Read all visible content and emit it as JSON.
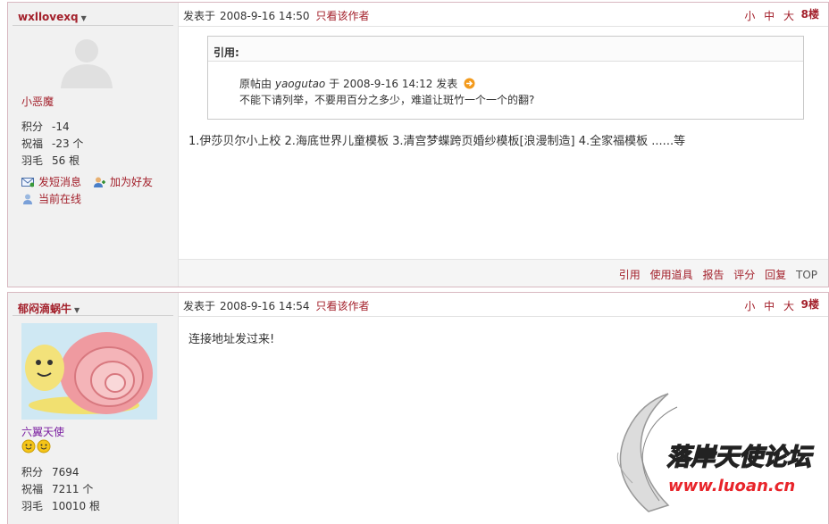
{
  "posts": [
    {
      "username": "wxllovexq",
      "rank": "小恶魔",
      "stats": [
        {
          "label": "积分",
          "value": "-14"
        },
        {
          "label": "祝福",
          "value": "-23 个"
        },
        {
          "label": "羽毛",
          "value": "56 根"
        }
      ],
      "actions": {
        "message": "发短消息",
        "add_friend": "加为好友",
        "online": "当前在线"
      },
      "posted_label": "发表于",
      "date": "2008-9-16 14:50",
      "only_author": "只看该作者",
      "size_labels": "小 中 大",
      "floor": "8楼",
      "quote": {
        "title": "引用:",
        "orig_prefix": "原帖由",
        "orig_author": "yaogutao",
        "orig_mid": "于",
        "orig_date": "2008-9-16 14:12 发表",
        "text": "不能下请列举，不要用百分之多少，难道让斑竹一个一个的翻?"
      },
      "content": "1.伊莎贝尔小上校  2.海底世界儿童模板  3.清宫梦蝶跨页婚纱模板[浪漫制造]  4.全家福模板  ......等",
      "footer_links": [
        "引用",
        "使用道具",
        "报告",
        "评分",
        "回复",
        "TOP"
      ]
    },
    {
      "username": "郁闷滴蜗牛",
      "rank": "六翼天使",
      "stats": [
        {
          "label": "积分",
          "value": "7694"
        },
        {
          "label": "祝福",
          "value": "7211 个"
        },
        {
          "label": "羽毛",
          "value": "10010 根"
        }
      ],
      "posted_label": "发表于",
      "date": "2008-9-16 14:54",
      "only_author": "只看该作者",
      "size_labels": "小 中 大",
      "floor": "9楼",
      "content": "连接地址发过来!"
    }
  ],
  "watermark": {
    "title": "落岸天使论坛",
    "url": "www.luoan.cn"
  },
  "colors": {
    "accent": "#a3202b",
    "sidebar_bg": "#f1f1f1",
    "border": "#d8b8c0",
    "rank2": "#7a1ea0"
  }
}
